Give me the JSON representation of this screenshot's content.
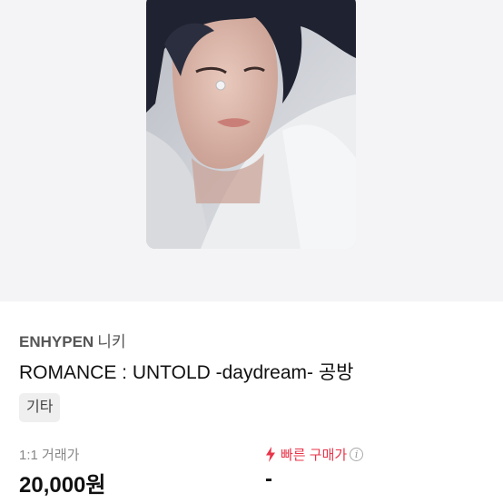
{
  "product": {
    "artist_group": "ENHYPEN",
    "artist_member": "니키",
    "title": "ROMANCE : UNTOLD -daydream- 공방",
    "tag": "기타",
    "photo_icon": "photocard-image"
  },
  "pricing": {
    "trade_label": "1:1 거래가",
    "trade_price": "20,000원",
    "quick_label": "빠른 구매가",
    "quick_price": "-",
    "quick_icon": "lightning-icon",
    "info_icon": "info-icon"
  },
  "colors": {
    "accent": "#e8344a",
    "hero_bg": "#f4f4f6",
    "tag_bg": "#efefef"
  }
}
